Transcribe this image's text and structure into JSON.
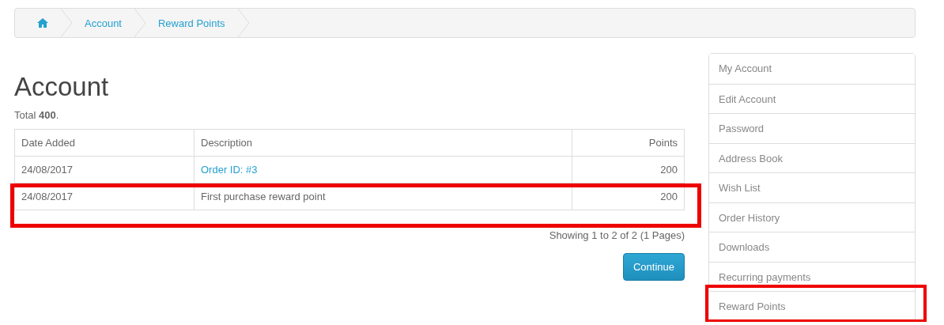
{
  "breadcrumb": [
    {
      "kind": "home"
    },
    {
      "kind": "link",
      "label": "Account"
    },
    {
      "kind": "link",
      "label": "Reward Points"
    }
  ],
  "heading": "Account",
  "total": "Total **400**.",
  "table": {
    "columns": [
      {
        "label": "Date Added"
      },
      {
        "label": "Description"
      },
      {
        "label": "Points"
      }
    ],
    "rows": [
      {
        "highlighted": false,
        "cells": [
          {
            "kind": "text",
            "text": "24/08/2017"
          },
          {
            "kind": "link",
            "text": "Order ID: #3"
          },
          {
            "kind": "text",
            "text": "200"
          }
        ]
      },
      {
        "highlighted": true,
        "cells": [
          {
            "kind": "text",
            "text": "24/08/2017"
          },
          {
            "kind": "text",
            "text": "First purchase reward point"
          },
          {
            "kind": "text",
            "text": "200"
          }
        ]
      }
    ]
  },
  "pagination": "Showing 1 to 2 of 2 (1 Pages)",
  "continue_button": "Continue",
  "sidebar": {
    "items": [
      {
        "label": "My Account",
        "selected": false,
        "highlighted": false
      },
      {
        "label": "Edit Account",
        "selected": false,
        "highlighted": false
      },
      {
        "label": "Password",
        "selected": false,
        "highlighted": false
      },
      {
        "label": "Address Book",
        "selected": false,
        "highlighted": false
      },
      {
        "label": "Wish List",
        "selected": false,
        "highlighted": false
      },
      {
        "label": "Order History",
        "selected": false,
        "highlighted": false
      },
      {
        "label": "Downloads",
        "selected": false,
        "highlighted": false
      },
      {
        "label": "Recurring payments",
        "selected": false,
        "highlighted": false
      },
      {
        "label": "Reward Points",
        "selected": false,
        "highlighted": true
      }
    ]
  }
}
